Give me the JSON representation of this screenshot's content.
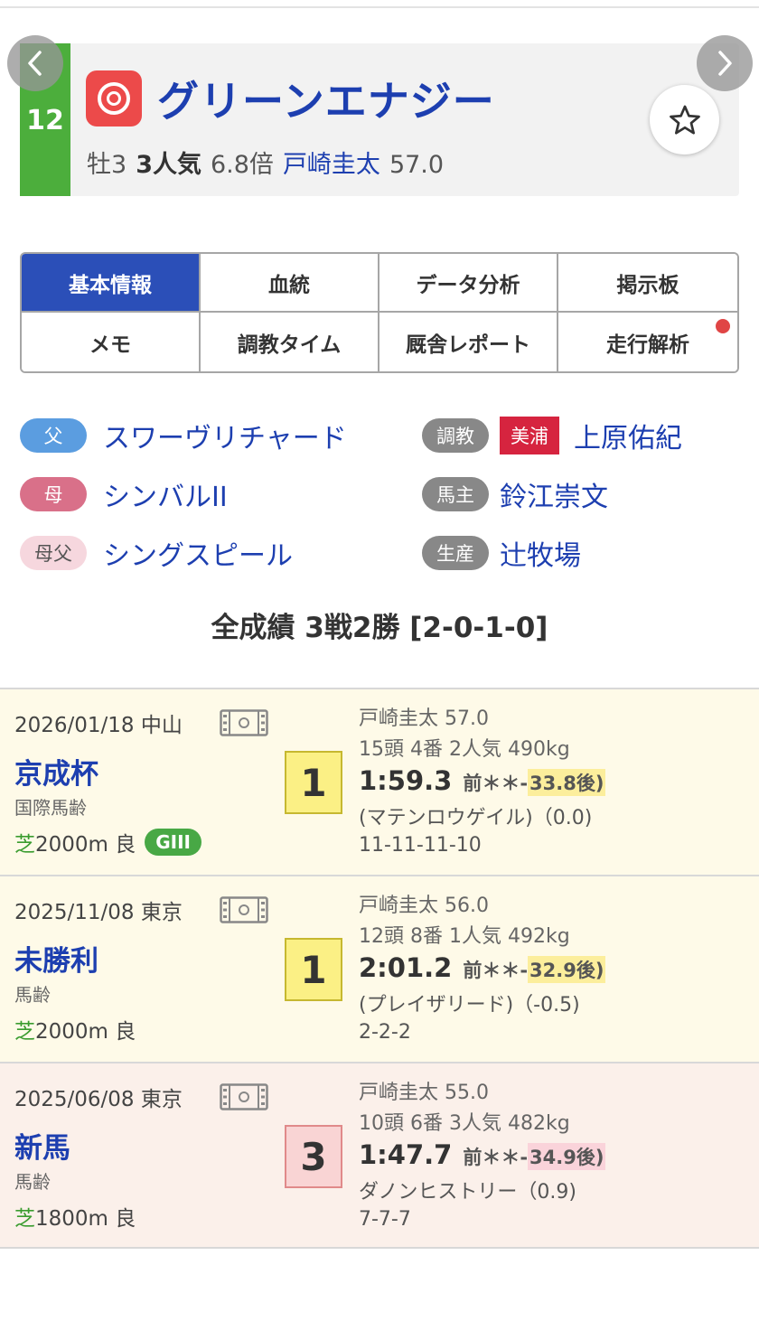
{
  "header": {
    "post_number": "12",
    "horse_name": "グリーンエナジー",
    "sex_age": "牡3",
    "popularity": "3人気",
    "odds": "6.8倍",
    "jockey": "戸崎圭太",
    "weight": "57.0",
    "prev_icon": "‹",
    "next_icon": "›",
    "mark_icon": "double-circle-mark-icon",
    "favorite_icon": "star-icon"
  },
  "tabs": [
    {
      "label": "基本情報",
      "active": true
    },
    {
      "label": "血統"
    },
    {
      "label": "データ分析"
    },
    {
      "label": "掲示板"
    },
    {
      "label": "メモ"
    },
    {
      "label": "調教タイム"
    },
    {
      "label": "厩舎レポート"
    },
    {
      "label": "走行解析",
      "has_notification": true
    }
  ],
  "pedigree": {
    "sire_label": "父",
    "sire": "スワーヴリチャード",
    "dam_label": "母",
    "dam": "シンバルII",
    "damsire_label": "母父",
    "damsire": "シングスピール",
    "trainer_label": "調教",
    "trainer_location": "美浦",
    "trainer": "上原佑紀",
    "owner_label": "馬主",
    "owner": "鈴江崇文",
    "breeder_label": "生産",
    "breeder": "辻牧場"
  },
  "record": {
    "summary": "全成績 3戦2勝 [2-0-1-0]"
  },
  "races": [
    {
      "date_venue": "2026/01/18 中山",
      "race_name": "京成杯",
      "condition": "国際馬齢",
      "surface": "芝",
      "distance_going": "2000m 良",
      "grade": "GIII",
      "finish": "1",
      "jockey_weight": "戸崎圭太 57.0",
      "field_info": "15頭 4番 2人気 490kg",
      "time": "1:59.3",
      "pace": "前＊＊-",
      "last3f": "33.8後)",
      "margin": "(マテンロウゲイル)（0.0)",
      "passing": "11-11-11-10"
    },
    {
      "date_venue": "2025/11/08 東京",
      "race_name": "未勝利",
      "condition": "馬齢",
      "surface": "芝",
      "distance_going": "2000m 良",
      "grade": "",
      "finish": "1",
      "jockey_weight": "戸崎圭太 56.0",
      "field_info": "12頭 8番 1人気 492kg",
      "time": "2:01.2",
      "pace": "前＊＊-",
      "last3f": "32.9後)",
      "margin": "(プレイザリード)（-0.5)",
      "passing": "2-2-2"
    },
    {
      "date_venue": "2025/06/08 東京",
      "race_name": "新馬",
      "condition": "馬齢",
      "surface": "芝",
      "distance_going": "1800m 良",
      "grade": "",
      "finish": "3",
      "jockey_weight": "戸崎圭太 55.0",
      "field_info": "10頭 6番 3人気 482kg",
      "time": "1:47.7",
      "pace": "前＊＊-",
      "last3f": "34.9後)",
      "margin": "ダノンヒストリー（0.9)",
      "passing": "7-7-7"
    }
  ],
  "colors": {
    "post_green": "#4cae3c",
    "link_blue": "#1d3fb0",
    "active_tab": "#2b4fb8",
    "win_row_bg": "#fefae8",
    "place_row_bg": "#fbf0ea"
  }
}
